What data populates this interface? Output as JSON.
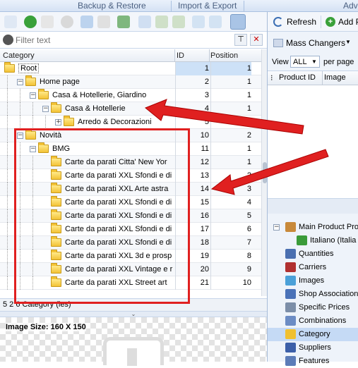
{
  "top_tabs": [
    "Backup & Restore",
    "Import & Export",
    "Adv"
  ],
  "filter": {
    "placeholder": "Filter text"
  },
  "columns": {
    "category": "Category",
    "id": "ID",
    "position": "Position"
  },
  "rows": [
    {
      "label": "Root",
      "id": "1",
      "pos": "1",
      "level": 0,
      "expander": "",
      "selected": true
    },
    {
      "label": "Home page",
      "id": "2",
      "pos": "1",
      "level": 1,
      "expander": "−"
    },
    {
      "label": "Casa & Hotellerie, Giardino",
      "id": "3",
      "pos": "1",
      "level": 2,
      "expander": "−"
    },
    {
      "label": "Casa & Hotellerie",
      "id": "4",
      "pos": "1",
      "level": 3,
      "expander": "−"
    },
    {
      "label": "Arredo & Decorazioni",
      "id": "5",
      "pos": "1",
      "level": 4,
      "expander": "+"
    },
    {
      "label": "Novità",
      "id": "10",
      "pos": "2",
      "level": 1,
      "expander": "−"
    },
    {
      "label": "BMG",
      "id": "11",
      "pos": "1",
      "level": 2,
      "expander": "−"
    },
    {
      "label": "Carte da parati  Citta'  New Yor",
      "id": "12",
      "pos": "1",
      "level": 3,
      "expander": ""
    },
    {
      "label": "Carte da parati XXL  Sfondi e di",
      "id": "13",
      "pos": "2",
      "level": 3,
      "expander": ""
    },
    {
      "label": "Carte da parati XXL  Arte astra",
      "id": "14",
      "pos": "3",
      "level": 3,
      "expander": ""
    },
    {
      "label": "Carte da parati XXL  Sfondi e di",
      "id": "15",
      "pos": "4",
      "level": 3,
      "expander": ""
    },
    {
      "label": "Carte da parati XXL  Sfondi e di",
      "id": "16",
      "pos": "5",
      "level": 3,
      "expander": ""
    },
    {
      "label": "Carte da parati XXL  Sfondi e di",
      "id": "17",
      "pos": "6",
      "level": 3,
      "expander": ""
    },
    {
      "label": "Carte da parati XXL  Sfondi e di",
      "id": "18",
      "pos": "7",
      "level": 3,
      "expander": ""
    },
    {
      "label": "Carte da parati XXL  3d e prosp",
      "id": "19",
      "pos": "8",
      "level": 3,
      "expander": ""
    },
    {
      "label": "Carte da parati XXL  Vintage e r",
      "id": "20",
      "pos": "9",
      "level": 3,
      "expander": ""
    },
    {
      "label": "Carte da parati XXL  Street art",
      "id": "21",
      "pos": "10",
      "level": 3,
      "expander": ""
    }
  ],
  "status_text": "5 2 6 Category (ies)",
  "image_size": "Image Size: 160 X 150",
  "right": {
    "refresh": "Refresh",
    "add": "Add P",
    "mass_changers": "Mass Changers",
    "view_label": "View",
    "view_value": "ALL",
    "per_page": "per page",
    "col_product_id": "Product ID",
    "col_image": "Image",
    "property_items": [
      {
        "label": "Main Product Prop",
        "icon": "box-icon"
      },
      {
        "label": "Italiano (Italia",
        "icon": "italy-flag-icon"
      },
      {
        "label": "Quantities",
        "icon": "123-icon"
      },
      {
        "label": "Carriers",
        "icon": "truck-icon"
      },
      {
        "label": "Images",
        "icon": "images-icon"
      },
      {
        "label": "Shop Associations",
        "icon": "shop-icon"
      },
      {
        "label": "Specific Prices",
        "icon": "tag-icon"
      },
      {
        "label": "Combinations",
        "icon": "combinations-icon"
      },
      {
        "label": "Category",
        "icon": "folder-icon"
      },
      {
        "label": "Suppliers",
        "icon": "suppliers-icon"
      },
      {
        "label": "Features",
        "icon": "features-icon"
      }
    ]
  },
  "colors": {
    "accent": "#3c6fb4",
    "annotation": "#e02020",
    "selected_row": "#cde1f7"
  }
}
